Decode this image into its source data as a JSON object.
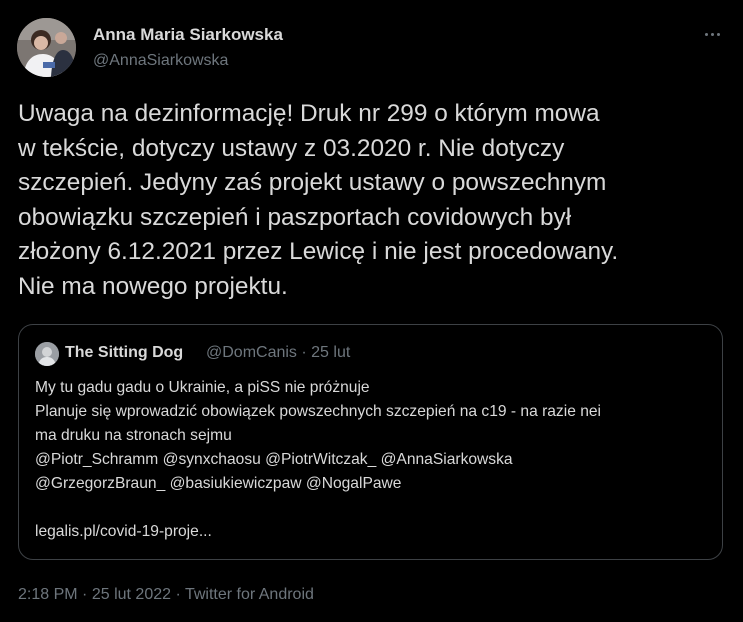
{
  "author": {
    "name": "Anna Maria Siarkowska",
    "handle": "@AnnaSiarkowska",
    "avatar_icon": "profile-photo"
  },
  "menu": {
    "icon": "more-horizontal-icon"
  },
  "tweet": {
    "text": "Uwaga na dezinformację! Druk nr 299 o którym mowa\nw tekście, dotyczy ustawy z 03.2020 r. Nie dotyczy\nszczepień. Jedyny zaś projekt ustawy o powszechnym\nobowiązku szczepień i paszportach covidowych był\nzłożony 6.12.2021 przez Lewicę i nie jest procedowany.\nNie ma nowego projektu."
  },
  "quote": {
    "name": "The Sitting Dog",
    "meta": "@DomCanis · 25 lut",
    "text": "My tu gadu gadu o Ukrainie, a piSS nie próżnuje\nPlanuje się wprowadzić obowiązek powszechnych szczepień na c19 - na razie nei\nma druku na stronach sejmu\n@Piotr_Schramm @synxchaosu @PiotrWitczak_ @AnnaSiarkowska\n@GrzegorzBraun_ @basiukiewiczpaw @NogalPawe\n",
    "link": "legalis.pl/covid-19-proje..."
  },
  "footer": {
    "time": "2:18 PM",
    "date": "25 lut 2022",
    "separator": "·",
    "source": "Twitter for Android"
  },
  "colors": {
    "background": "#000000",
    "text": "#d9d9d9",
    "secondary": "#6e767d",
    "border": "#3d4145"
  }
}
